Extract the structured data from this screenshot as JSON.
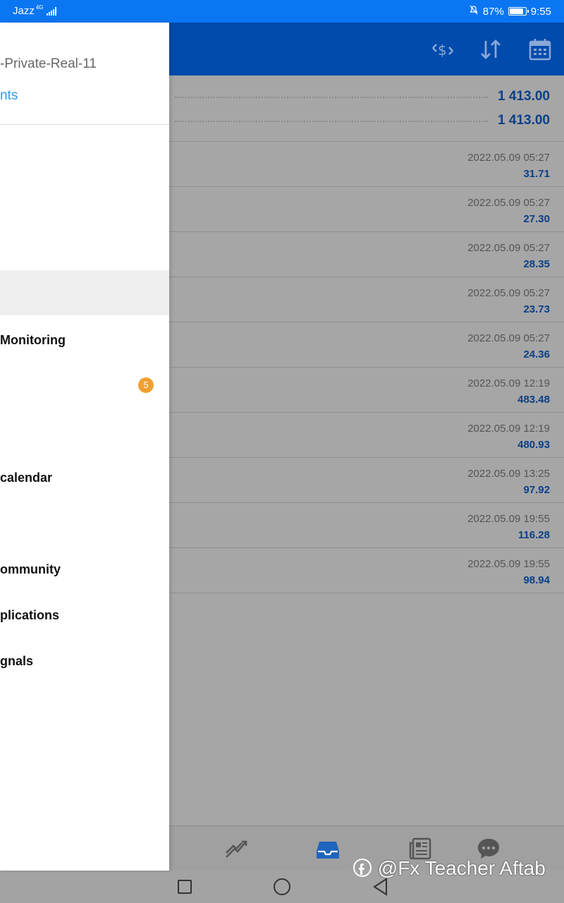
{
  "status_bar": {
    "carrier": "Jazz",
    "network": "4G",
    "battery": "87%",
    "time": "9:55",
    "icons": [
      "signal-icon",
      "mute-icon",
      "battery-icon"
    ]
  },
  "header": {
    "icons": [
      "trade-exchange-icon",
      "sort-icon",
      "calendar-icon"
    ]
  },
  "balances": [
    "1 413.00",
    "1 413.00"
  ],
  "deals": [
    {
      "time": "2022.05.09 05:27",
      "profit": "31.71"
    },
    {
      "time": "2022.05.09 05:27",
      "profit": "27.30"
    },
    {
      "time": "2022.05.09 05:27",
      "profit": "28.35"
    },
    {
      "time": "2022.05.09 05:27",
      "profit": "23.73"
    },
    {
      "time": "2022.05.09 05:27",
      "profit": "24.36"
    },
    {
      "time": "2022.05.09 12:19",
      "profit": "483.48"
    },
    {
      "time": "2022.05.09 12:19",
      "profit": "480.93"
    },
    {
      "time": "2022.05.09 13:25",
      "profit": "97.92"
    },
    {
      "time": "2022.05.09 19:55",
      "profit": "116.28"
    },
    {
      "time": "2022.05.09 19:55",
      "profit": "98.94"
    }
  ],
  "drawer": {
    "account_name": "-Private-Real-11",
    "manage_link": "nts",
    "items": [
      {
        "label": "Monitoring"
      },
      {
        "label": "",
        "badge": "5"
      },
      {
        "label": "calendar"
      },
      {
        "label": "ommunity"
      },
      {
        "label": "plications"
      },
      {
        "label": "gnals"
      }
    ]
  },
  "tabbar": {
    "tabs": [
      "chart-tab-icon",
      "history-tab-icon",
      "news-tab-icon",
      "chat-tab-icon"
    ]
  },
  "watermark": "@Fx Teacher Aftab",
  "colors": {
    "status_bar": "#0a76f2",
    "header": "#004bac",
    "accent_link": "#2f9ae0",
    "badge": "#f0a030",
    "value_blue": "#0b3f86"
  }
}
